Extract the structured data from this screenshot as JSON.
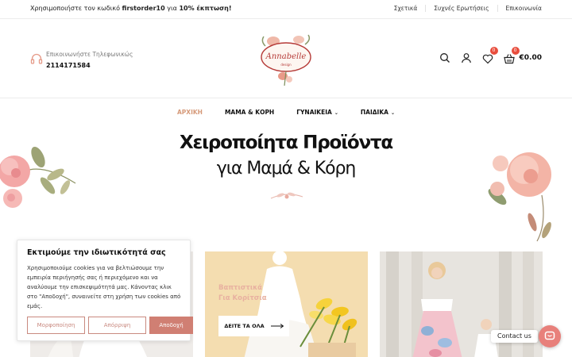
{
  "topbar": {
    "promo_prefix": "Χρησιμοποιήστε τον κωδικό ",
    "promo_code": "firstorder10",
    "promo_middle": " για ",
    "promo_discount": "10% έκπτωση!",
    "links": [
      "Σχετικά",
      "Συχνές Ερωτήσεις",
      "Επικοινωνία"
    ]
  },
  "header": {
    "phone_label": "Επικοινωνήστε Τηλεφωνικώς",
    "phone_number": "2114171584",
    "logo_text": "Annabelle",
    "logo_subtext": "design",
    "wishlist_count": "0",
    "cart_count": "0",
    "cart_total": "€0.00",
    "icons": [
      "headset-icon",
      "search-icon",
      "user-icon",
      "heart-icon",
      "basket-icon"
    ]
  },
  "nav": {
    "items": [
      {
        "label": "ΑΡΧΙΚΗ",
        "active": true
      },
      {
        "label": "ΜΑΜΑ & ΚΟΡΗ",
        "active": false
      },
      {
        "label": "ΓΥΝΑΙΚΕΙΑ",
        "active": false,
        "dropdown": true
      },
      {
        "label": "ΠΑΙΔΙΚΑ",
        "active": false,
        "dropdown": true
      }
    ]
  },
  "hero": {
    "title": "Χειροποίητα Προϊόντα",
    "subtitle": "για Μαμά & Κόρη"
  },
  "cards": [
    {
      "title_line1": "Βαπτιστικά",
      "title_line2": "Για Κορίτσια",
      "button": "ΔΕΙΤΕ ΤΑ ΟΛΑ"
    }
  ],
  "cookie": {
    "title": "Εκτιμούμε την ιδιωτικότητά σας",
    "text": "Χρησιμοποιούμε cookies για να βελτιώσουμε την εμπειρία περιήγησής σας ή περιεχόμενο και να αναλύουμε την επισκεψιμότητά μας. Κάνοντας κλικ στο \"Αποδοχή\", συναινείτε στη χρήση των cookies από εμάς.",
    "btn_customize": "Μορφοποίηση",
    "btn_reject": "Απόρριψη",
    "btn_accept": "Αποδοχή"
  },
  "contact": {
    "label": "Contact us"
  },
  "colors": {
    "accent": "#d69a7a",
    "badge": "#e84d3d",
    "cookie_accent": "#d07f73",
    "chat": "#e8807b"
  }
}
